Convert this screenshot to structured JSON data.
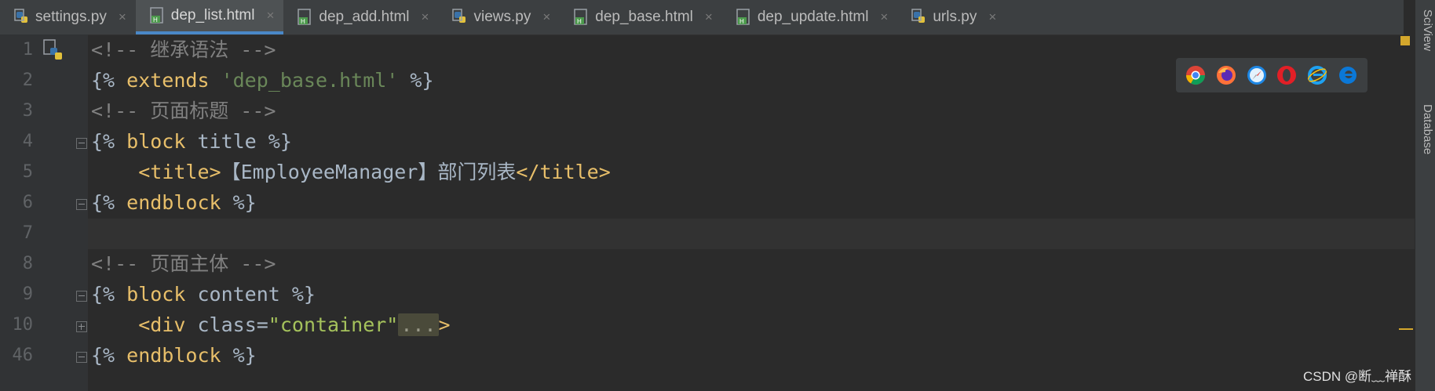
{
  "tabs": [
    {
      "label": "settings.py",
      "type": "py",
      "active": false
    },
    {
      "label": "dep_list.html",
      "type": "html",
      "active": true
    },
    {
      "label": "dep_add.html",
      "type": "html",
      "active": false
    },
    {
      "label": "views.py",
      "type": "py",
      "active": false
    },
    {
      "label": "dep_base.html",
      "type": "html",
      "active": false
    },
    {
      "label": "dep_update.html",
      "type": "html",
      "active": false
    },
    {
      "label": "urls.py",
      "type": "py",
      "active": false
    }
  ],
  "tab_close_glyph": "×",
  "line_numbers": [
    "1",
    "2",
    "3",
    "4",
    "5",
    "6",
    "7",
    "8",
    "9",
    "10",
    "46"
  ],
  "code": {
    "l1": "<!-- 继承语法 -->",
    "l2_open": "{% ",
    "l2_kw": "extends",
    "l2_str": "'dep_base.html'",
    "l2_close": " %}",
    "l3": "<!-- 页面标题 -->",
    "l4_open": "{% ",
    "l4_kw": "block",
    "l4_rest": " title %}",
    "l5_open": "<title>",
    "l5_text": "【EmployeeManager】部门列表",
    "l5_close": "</title>",
    "l6_open": "{% ",
    "l6_kw": "endblock",
    "l6_close": " %}",
    "l8": "<!-- 页面主体 -->",
    "l9_open": "{% ",
    "l9_kw": "block",
    "l9_rest": " content %}",
    "l10_tag": "<div",
    "l10_attr": " class=",
    "l10_val": "\"container\"",
    "l10_fold": "...",
    "l10_end": ">",
    "l46_open": "{% ",
    "l46_kw": "endblock",
    "l46_close": " %}"
  },
  "browsers": [
    "chrome-icon",
    "firefox-icon",
    "safari-icon",
    "opera-icon",
    "ie-icon",
    "edge-icon"
  ],
  "side_panels": [
    "SciView",
    "Database"
  ],
  "watermark": "CSDN @断﹏禅酥",
  "colors": {
    "editor_bg": "#2b2b2b",
    "comment": "#808080",
    "tag": "#e8bf6a",
    "string": "#6a8759",
    "active_tab_underline": "#4a88c7"
  }
}
